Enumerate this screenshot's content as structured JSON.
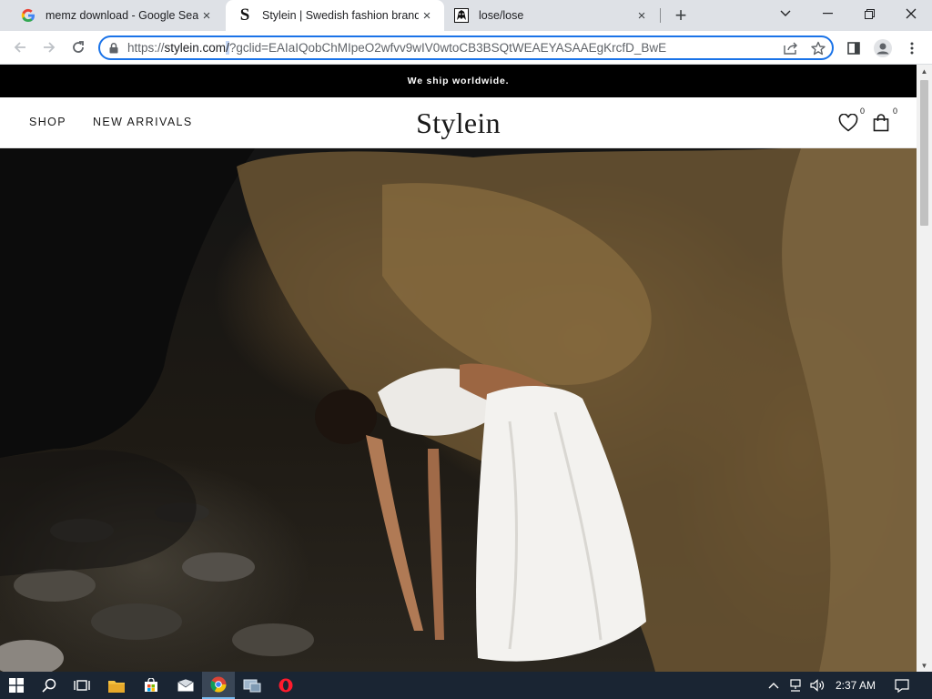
{
  "tabs": [
    {
      "title": "memz download - Google Search",
      "favicon": "google-g-icon",
      "close": "×"
    },
    {
      "title": "Stylein | Swedish fashion brand",
      "favicon": "stylein-s-icon",
      "close": "×"
    },
    {
      "title": "lose/lose",
      "favicon": "alien-icon",
      "close": "×"
    }
  ],
  "window": {
    "minimize": "—",
    "restore": "❐",
    "close": "✕",
    "tablist": "⌄",
    "newtab": "+"
  },
  "omnibox": {
    "scheme": "https://",
    "host": "stylein.com",
    "slash": "/",
    "path": "?gclid=EAIaIQobChMIpeO2wfvv9wIV0wtoCB3BSQtWEAEYASAAEgKrcfD_BwE"
  },
  "site": {
    "announcement": "We ship worldwide.",
    "nav": [
      "SHOP",
      "NEW ARRIVALS"
    ],
    "logo": "Stylein",
    "wishlist_count": "0",
    "cart_count": "0"
  },
  "taskbar": {
    "time": "2:37 AM"
  },
  "colors": {
    "accent": "#1a73e8",
    "taskbar": "#1a2533",
    "announcement_bg": "#000000"
  }
}
